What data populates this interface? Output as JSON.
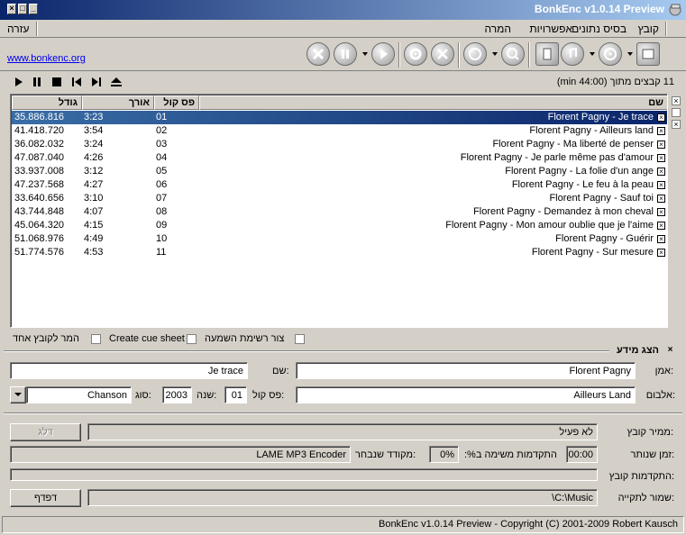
{
  "window": {
    "title": "BonkEnc v1.0.14 Preview"
  },
  "menu": {
    "items": [
      "קובץ",
      "בסיס נתונים",
      "אפשרויות",
      "המרה"
    ],
    "help": "עזרה"
  },
  "link": "www.bonkenc.org",
  "list": {
    "file_count": "11 קבצים מתוך (44:00 min)",
    "headers": {
      "name": "שם",
      "track": "פס קול",
      "length": "אורך",
      "size": "גודל"
    },
    "rows": [
      {
        "name": "Florent Pagny - Je trace",
        "track": "01",
        "length": "3:23",
        "size": "35.886.816",
        "selected": true
      },
      {
        "name": "Florent Pagny - Ailleurs land",
        "track": "02",
        "length": "3:54",
        "size": "41.418.720"
      },
      {
        "name": "Florent Pagny - Ma liberté de penser",
        "track": "03",
        "length": "3:24",
        "size": "36.082.032"
      },
      {
        "name": "Florent Pagny - Je parle même pas d'amour",
        "track": "04",
        "length": "4:26",
        "size": "47.087.040"
      },
      {
        "name": "Florent Pagny - La folie d'un ange",
        "track": "05",
        "length": "3:12",
        "size": "33.937.008"
      },
      {
        "name": "Florent Pagny - Le feu à la peau",
        "track": "06",
        "length": "4:27",
        "size": "47.237.568"
      },
      {
        "name": "Florent Pagny - Sauf toi",
        "track": "07",
        "length": "3:10",
        "size": "33.640.656"
      },
      {
        "name": "Florent Pagny - Demandez à mon cheval",
        "track": "08",
        "length": "4:07",
        "size": "43.744.848"
      },
      {
        "name": "Florent Pagny - Mon amour oublie que je l'aime",
        "track": "09",
        "length": "4:15",
        "size": "45.064.320"
      },
      {
        "name": "Florent Pagny - Guérir",
        "track": "10",
        "length": "4:49",
        "size": "51.068.976"
      },
      {
        "name": "Florent Pagny - Sur mesure",
        "track": "11",
        "length": "4:53",
        "size": "51.774.576"
      }
    ]
  },
  "options": {
    "playlist": "צור רשימת השמעה",
    "cue": "Create cue sheet",
    "single": "המר לקובץ אחד"
  },
  "info": {
    "toggle": "הצג מידע",
    "artist_label": "אמן:",
    "artist": "Florent Pagny",
    "title_label": "שם:",
    "title": "Je trace",
    "album_label": "אלבום:",
    "album": "Ailleurs Land",
    "track_label": "פס קול:",
    "track": "01",
    "year_label": "שנה:",
    "year": "2003",
    "genre_label": "סוג:",
    "genre": "Chanson"
  },
  "status": {
    "encoder_label": "ממיר קובץ:",
    "encoder_value": "לא פעיל",
    "skip": "דלג",
    "time_label": "זמן שנותר:",
    "time": "00:00",
    "progress_label": "התקדמות משימה ב%:",
    "percent": "0%",
    "selected_label": "מקודד שנבחר:",
    "selected_encoder": "LAME MP3 Encoder",
    "file_progress_label": "התקדמות קובץ:",
    "output_label": "שמור לתקייה:",
    "output": "C:\\Music\\",
    "browse": "דפדף"
  },
  "statusbar": "BonkEnc v1.0.14 Preview - Copyright (C) 2001-2009 Robert Kausch"
}
